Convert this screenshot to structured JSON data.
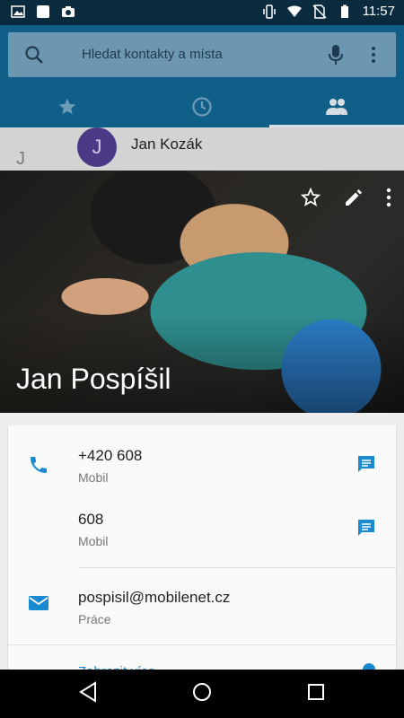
{
  "status_bar": {
    "time": "11:57",
    "icons": [
      "image-icon",
      "square-icon",
      "camera-icon",
      "vibrate-icon",
      "wifi-icon",
      "no-sim-icon",
      "battery-icon"
    ]
  },
  "search": {
    "placeholder": "Hledat kontakty a místa"
  },
  "tabs": [
    {
      "name": "favorites",
      "icon": "star-icon"
    },
    {
      "name": "recents",
      "icon": "clock-icon"
    },
    {
      "name": "contacts",
      "icon": "people-icon",
      "selected": true
    }
  ],
  "list_peek": {
    "section_letter": "J",
    "avatar_letter": "J",
    "name": "Jan Kozák"
  },
  "contact": {
    "name": "Jan Pospíšil",
    "phones": [
      {
        "number": "+420 608",
        "label": "Mobil"
      },
      {
        "number": "608",
        "label": "Mobil"
      }
    ],
    "email": {
      "address": "pospisil@mobilenet.cz",
      "label": "Práce"
    },
    "partial_row_text": "Zobrazit více"
  },
  "colors": {
    "app_bar": "#0f5f89",
    "accent": "#1a8ad0"
  }
}
